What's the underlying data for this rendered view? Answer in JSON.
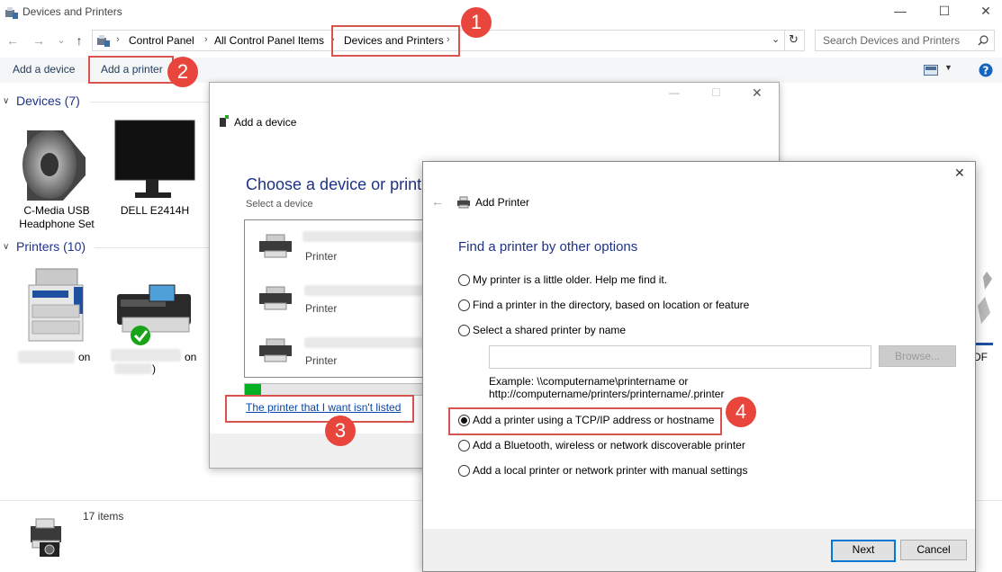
{
  "window": {
    "title": "Devices and Printers",
    "controls": [
      "—",
      "☐",
      "✕"
    ]
  },
  "nav": {
    "back": "←",
    "forward": "→",
    "recent": "⌄",
    "up": "↑",
    "breadcrumb": [
      "Control Panel",
      "All Control Panel Items",
      "Devices and Printers"
    ],
    "refresh": "↻",
    "search_placeholder": "Search Devices and Printers"
  },
  "toolbar": {
    "add_device": "Add a device",
    "add_printer": "Add a printer"
  },
  "devices": {
    "heading": "Devices (7)",
    "items": [
      {
        "label": "C-Media USB Headphone Set"
      },
      {
        "label": "DELL E2414H"
      }
    ]
  },
  "printers": {
    "heading": "Printers (10)",
    "items": [
      {
        "label_suffix": "on"
      },
      {
        "label_suffix": "on",
        "label_tail": ")"
      }
    ],
    "right_edge_text": "DF"
  },
  "status": {
    "items_count": "17 items"
  },
  "add_device_dialog": {
    "title": "Add a device",
    "heading": "Choose a device or printe",
    "subheading": "Select a device",
    "list": [
      "Printer",
      "Printer",
      "Printer"
    ],
    "link": "The printer that I want isn't listed"
  },
  "add_printer_dialog": {
    "title": "Add Printer",
    "heading": "Find a printer by other options",
    "options": [
      {
        "label": "My printer is a little older. Help me find it.",
        "selected": false
      },
      {
        "label": "Find a printer in the directory, based on location or feature",
        "selected": false
      },
      {
        "label": "Select a shared printer by name",
        "selected": false
      },
      {
        "label": "Add a printer using a TCP/IP address or hostname",
        "selected": true
      },
      {
        "label": "Add a Bluetooth, wireless or network discoverable printer",
        "selected": false
      },
      {
        "label": "Add a local printer or network printer with manual settings",
        "selected": false
      }
    ],
    "shared_input_value": "",
    "browse": "Browse...",
    "example_line1": "Example: \\\\computername\\printername or",
    "example_line2": "http://computername/printers/printername/.printer",
    "next": "Next",
    "cancel": "Cancel"
  },
  "callouts": [
    "1",
    "2",
    "3",
    "4"
  ],
  "colors": {
    "callout": "#e8463d",
    "highlight": "#d9534f",
    "heading_blue": "#1e3287",
    "link_blue": "#0645ad",
    "accent": "#0078d7"
  }
}
